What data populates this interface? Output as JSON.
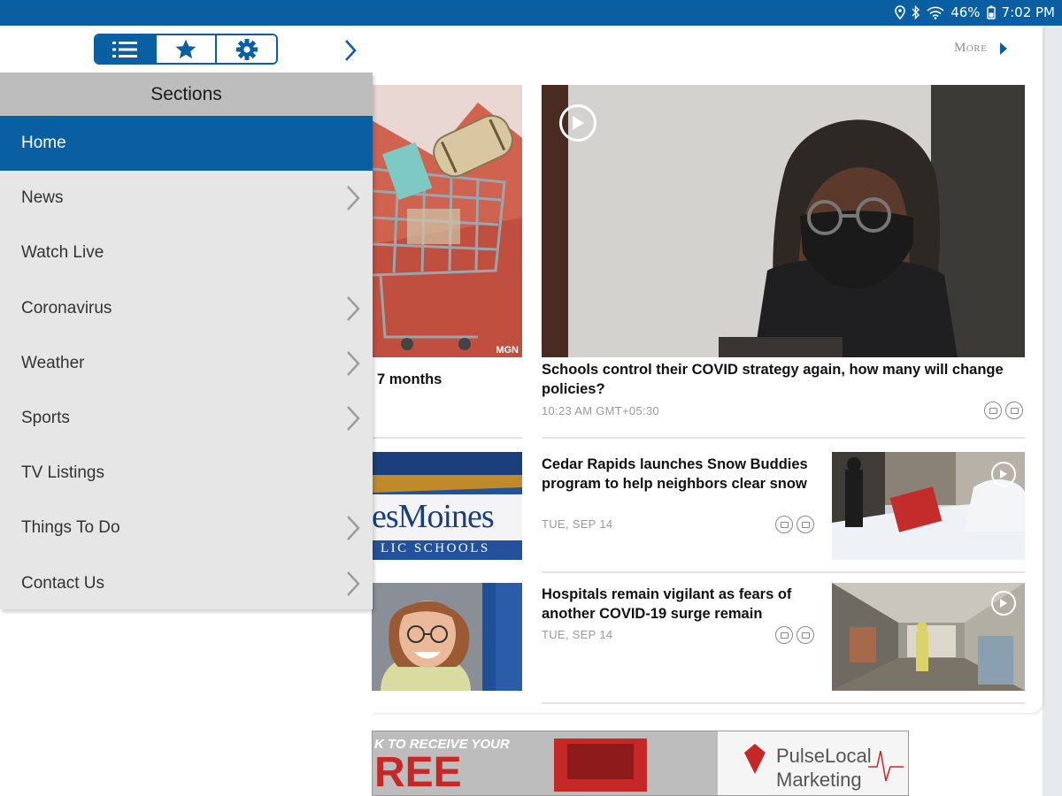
{
  "status_bar": {
    "battery": "46%",
    "time": "7:02 PM"
  },
  "toolbar": {
    "more_label": "More"
  },
  "drawer": {
    "title": "Sections",
    "items": [
      {
        "label": "Home",
        "active": true,
        "has_chevron": false
      },
      {
        "label": "News",
        "active": false,
        "has_chevron": true
      },
      {
        "label": "Watch Live",
        "active": false,
        "has_chevron": false
      },
      {
        "label": "Coronavirus",
        "active": false,
        "has_chevron": true
      },
      {
        "label": "Weather",
        "active": false,
        "has_chevron": true
      },
      {
        "label": "Sports",
        "active": false,
        "has_chevron": true
      },
      {
        "label": "TV Listings",
        "active": false,
        "has_chevron": false
      },
      {
        "label": "Things To Do",
        "active": false,
        "has_chevron": true
      },
      {
        "label": "Contact Us",
        "active": false,
        "has_chevron": true
      }
    ]
  },
  "stories": {
    "left_partial_title": "7 months",
    "left_image_watermark": "MGN",
    "desmoines_logo_line1": "esMoines",
    "desmoines_logo_line2": "LIC SCHOOLS",
    "featured": {
      "title": "Schools control their COVID strategy again, how many will change policies?",
      "time": "10:23 AM GMT+05:30"
    },
    "list": [
      {
        "title": "Cedar Rapids launches Snow Buddies program to help neighbors clear snow",
        "time": "TUE, SEP 14"
      },
      {
        "title": "Hospitals remain vigilant as fears of another COVID-19 surge remain",
        "time": "TUE, SEP 14"
      }
    ]
  },
  "ad": {
    "headline": "K TO RECEIVE YOUR",
    "big_word": "REE",
    "brand_line1": "PulseLocal",
    "brand_line2": "Marketing"
  },
  "colors": {
    "brand_blue": "#0a5fa3",
    "drawer_bg": "#e6e6e6",
    "drawer_header": "#bdbdbd"
  }
}
